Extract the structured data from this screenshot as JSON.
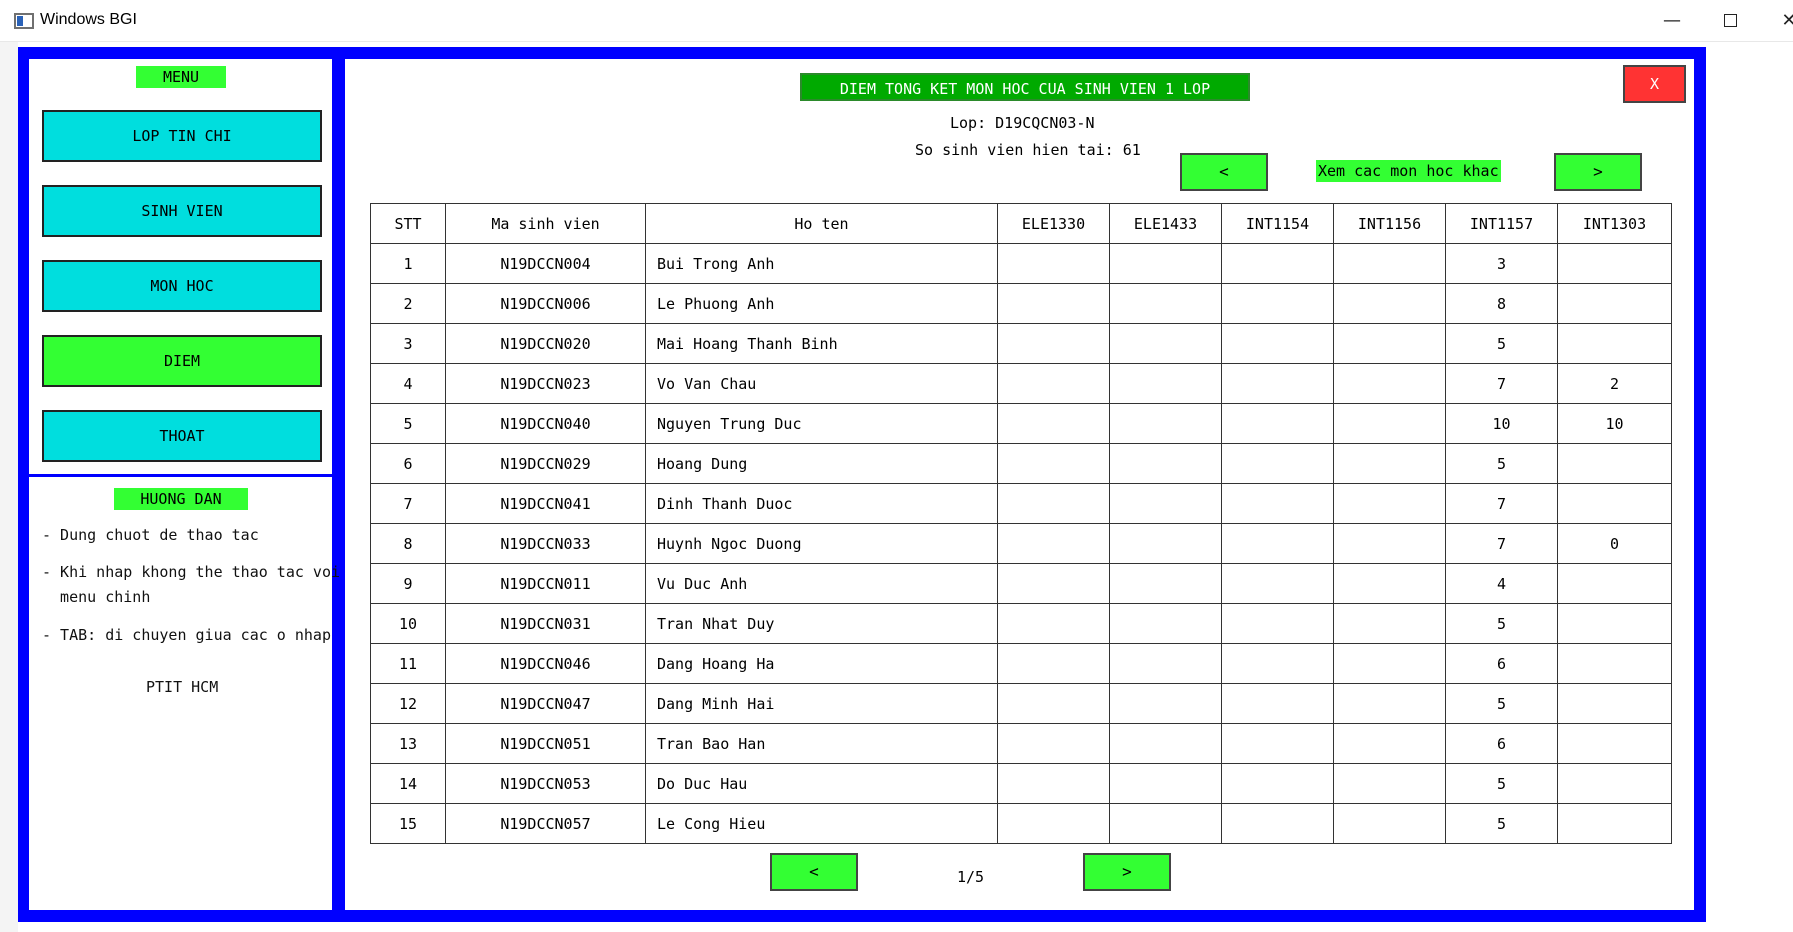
{
  "window": {
    "title": "Windows BGI",
    "minimize": "—",
    "close": "✕"
  },
  "sidebar": {
    "menu_title": "MENU",
    "items": [
      {
        "label": "LOP TIN CHI",
        "active": false
      },
      {
        "label": "SINH VIEN",
        "active": false
      },
      {
        "label": "MON HOC",
        "active": false
      },
      {
        "label": "DIEM",
        "active": true
      },
      {
        "label": "THOAT",
        "active": false
      }
    ],
    "guide_title": "HUONG DAN",
    "guide": [
      "- Dung chuot de thao tac",
      "- Khi nhap khong the thao tac voi",
      "  menu chinh",
      "- TAB: di chuyen giua cac o nhap"
    ],
    "brand": "PTIT HCM"
  },
  "main": {
    "title": "DIEM TONG KET MON HOC CUA SINH VIEN 1 LOP",
    "close_label": "X",
    "class_line": "Lop: D19CQCN03-N",
    "count_line": "So sinh vien hien tai: 61",
    "subject_nav": {
      "prev": "<",
      "label": "Xem cac mon hoc khac",
      "next": ">"
    },
    "pagination": {
      "prev": "<",
      "indicator": "1/5",
      "next": ">"
    }
  },
  "table": {
    "columns": [
      "STT",
      "Ma sinh vien",
      "Ho ten",
      "ELE1330",
      "ELE1433",
      "INT1154",
      "INT1156",
      "INT1157",
      "INT1303"
    ],
    "rows": [
      [
        "1",
        "N19DCCN004",
        "Bui Trong Anh",
        "",
        "",
        "",
        "",
        "3",
        ""
      ],
      [
        "2",
        "N19DCCN006",
        "Le Phuong Anh",
        "",
        "",
        "",
        "",
        "8",
        ""
      ],
      [
        "3",
        "N19DCCN020",
        "Mai Hoang Thanh Binh",
        "",
        "",
        "",
        "",
        "5",
        ""
      ],
      [
        "4",
        "N19DCCN023",
        "Vo Van Chau",
        "",
        "",
        "",
        "",
        "7",
        "2"
      ],
      [
        "5",
        "N19DCCN040",
        "Nguyen Trung Duc",
        "",
        "",
        "",
        "",
        "10",
        "10"
      ],
      [
        "6",
        "N19DCCN029",
        "Hoang Dung",
        "",
        "",
        "",
        "",
        "5",
        ""
      ],
      [
        "7",
        "N19DCCN041",
        "Dinh Thanh Duoc",
        "",
        "",
        "",
        "",
        "7",
        ""
      ],
      [
        "8",
        "N19DCCN033",
        "Huynh Ngoc Duong",
        "",
        "",
        "",
        "",
        "7",
        "0"
      ],
      [
        "9",
        "N19DCCN011",
        "Vu Duc Anh",
        "",
        "",
        "",
        "",
        "4",
        ""
      ],
      [
        "10",
        "N19DCCN031",
        "Tran Nhat Duy",
        "",
        "",
        "",
        "",
        "5",
        ""
      ],
      [
        "11",
        "N19DCCN046",
        "Dang Hoang Ha",
        "",
        "",
        "",
        "",
        "6",
        ""
      ],
      [
        "12",
        "N19DCCN047",
        "Dang Minh Hai",
        "",
        "",
        "",
        "",
        "5",
        ""
      ],
      [
        "13",
        "N19DCCN051",
        "Tran Bao Han",
        "",
        "",
        "",
        "",
        "6",
        ""
      ],
      [
        "14",
        "N19DCCN053",
        "Do Duc Hau",
        "",
        "",
        "",
        "",
        "5",
        ""
      ],
      [
        "15",
        "N19DCCN057",
        "Le Cong Hieu",
        "",
        "",
        "",
        "",
        "5",
        ""
      ]
    ]
  },
  "colors": {
    "frame": "#0000ff",
    "menu_button": "#00dede",
    "active_button": "#33ff33",
    "title_bar": "#00aa00",
    "close_button": "#ff3333"
  }
}
